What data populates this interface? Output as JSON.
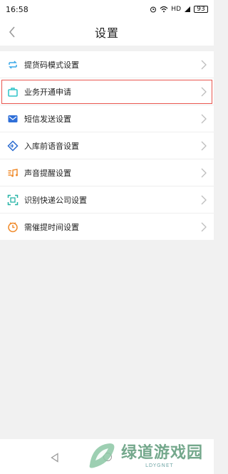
{
  "status": {
    "time": "16:58",
    "network": "HD",
    "battery": "93"
  },
  "header": {
    "title": "设置"
  },
  "items": [
    {
      "label": "提货码模式设置",
      "icon": "swap-arrows-icon",
      "color": "#3aa8e8"
    },
    {
      "label": "业务开通申请",
      "icon": "briefcase-icon",
      "color": "#2fc3c8"
    },
    {
      "label": "短信发送设置",
      "icon": "message-icon",
      "color": "#2f6fd8"
    },
    {
      "label": "入库前语音设置",
      "icon": "voice-icon",
      "color": "#2a6bd0"
    },
    {
      "label": "声音提醒设置",
      "icon": "sound-icon",
      "color": "#f08a2a"
    },
    {
      "label": "识别快递公司设置",
      "icon": "scan-icon",
      "color": "#25b3a6"
    },
    {
      "label": "需催提时间设置",
      "icon": "clock-icon",
      "color": "#f08a2a"
    }
  ],
  "highlight_color": "#e9564f",
  "watermark": {
    "text": "绿道游戏园",
    "sub": "LDYGNET"
  }
}
